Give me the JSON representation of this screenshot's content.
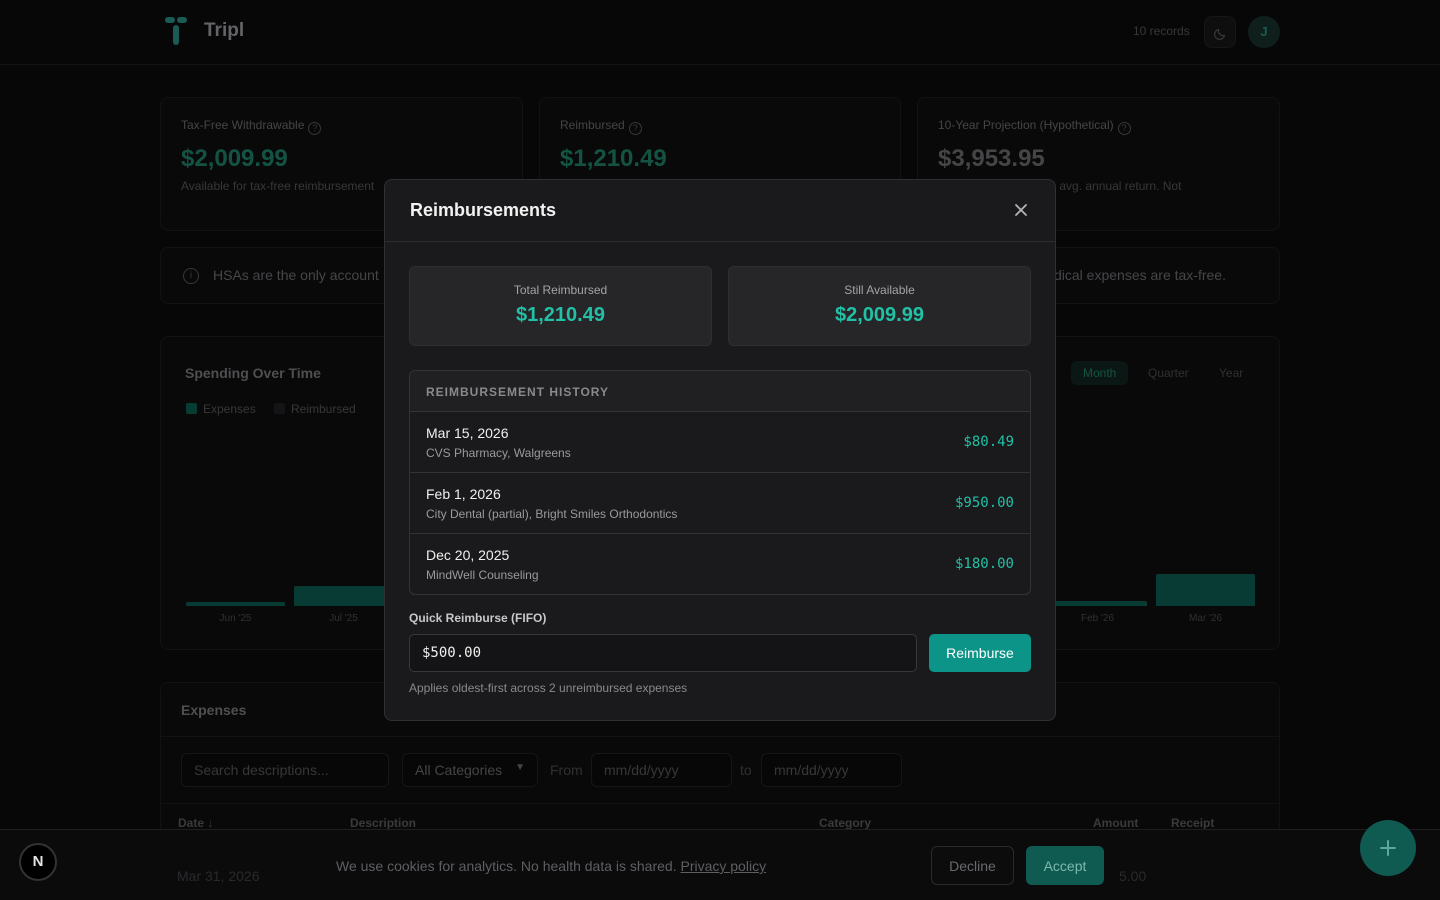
{
  "app": {
    "name": "Tripl",
    "records": "10 records",
    "avatar_initial": "J"
  },
  "stats": [
    {
      "label": "Tax-Free Withdrawable",
      "value": "$2,009.99",
      "sub": "Available for tax-free reimbursement"
    },
    {
      "label": "Reimbursed",
      "value": "$1,210.49",
      "sub": ""
    },
    {
      "label": "10-Year Projection (Hypothetical)",
      "value": "$3,953.95",
      "sub": "ng 7% avg. annual return. Not"
    }
  ],
  "info": {
    "text_left": "HSAs are the only account",
    "text_right": "dical expenses are tax-free."
  },
  "spending": {
    "title": "Spending Over Time",
    "legend": [
      "Expenses",
      "Reimbursed"
    ],
    "periods": [
      "Month",
      "Quarter",
      "Year"
    ],
    "active_period": "Month"
  },
  "chart_data": {
    "type": "bar",
    "categories": [
      "Jun '25",
      "Jul '25",
      "Feb '26",
      "Mar '26"
    ],
    "series": [
      {
        "name": "Expenses",
        "values": [
          4,
          20,
          5,
          32
        ]
      }
    ]
  },
  "expenses": {
    "title": "Expenses",
    "search_placeholder": "Search descriptions...",
    "category_select": "All Categories",
    "from_label": "From",
    "to_label": "to",
    "date_placeholder": "mm/dd/yyyy",
    "columns": [
      "Date ↓",
      "Description",
      "Category",
      "Amount",
      "Receipt"
    ]
  },
  "modal": {
    "title": "Reimbursements",
    "total_label": "Total Reimbursed",
    "total_value": "$1,210.49",
    "available_label": "Still Available",
    "available_value": "$2,009.99",
    "history_title": "REIMBURSEMENT HISTORY",
    "history": [
      {
        "date": "Mar 15, 2026",
        "vendors": "CVS Pharmacy, Walgreens",
        "amount": "$80.49"
      },
      {
        "date": "Feb 1, 2026",
        "vendors": "City Dental (partial), Bright Smiles Orthodontics",
        "amount": "$950.00"
      },
      {
        "date": "Dec 20, 2025",
        "vendors": "MindWell Counseling",
        "amount": "$180.00"
      }
    ],
    "quick_label": "Quick Reimburse (FIFO)",
    "quick_value": "$500.00",
    "quick_button": "Reimburse",
    "quick_hint": "Applies oldest-first across 2 unreimbursed expenses"
  },
  "cookie": {
    "text": "We use cookies for analytics. No health data is shared.",
    "link": "Privacy policy",
    "decline": "Decline",
    "accept": "Accept"
  },
  "ghost_row": {
    "date": "Mar 31, 2026",
    "amount": "5.00"
  },
  "badge": "N",
  "colors": {
    "accent": "#0d9488",
    "accent_text": "#22c0a6",
    "surface": "#1a1a1c"
  }
}
